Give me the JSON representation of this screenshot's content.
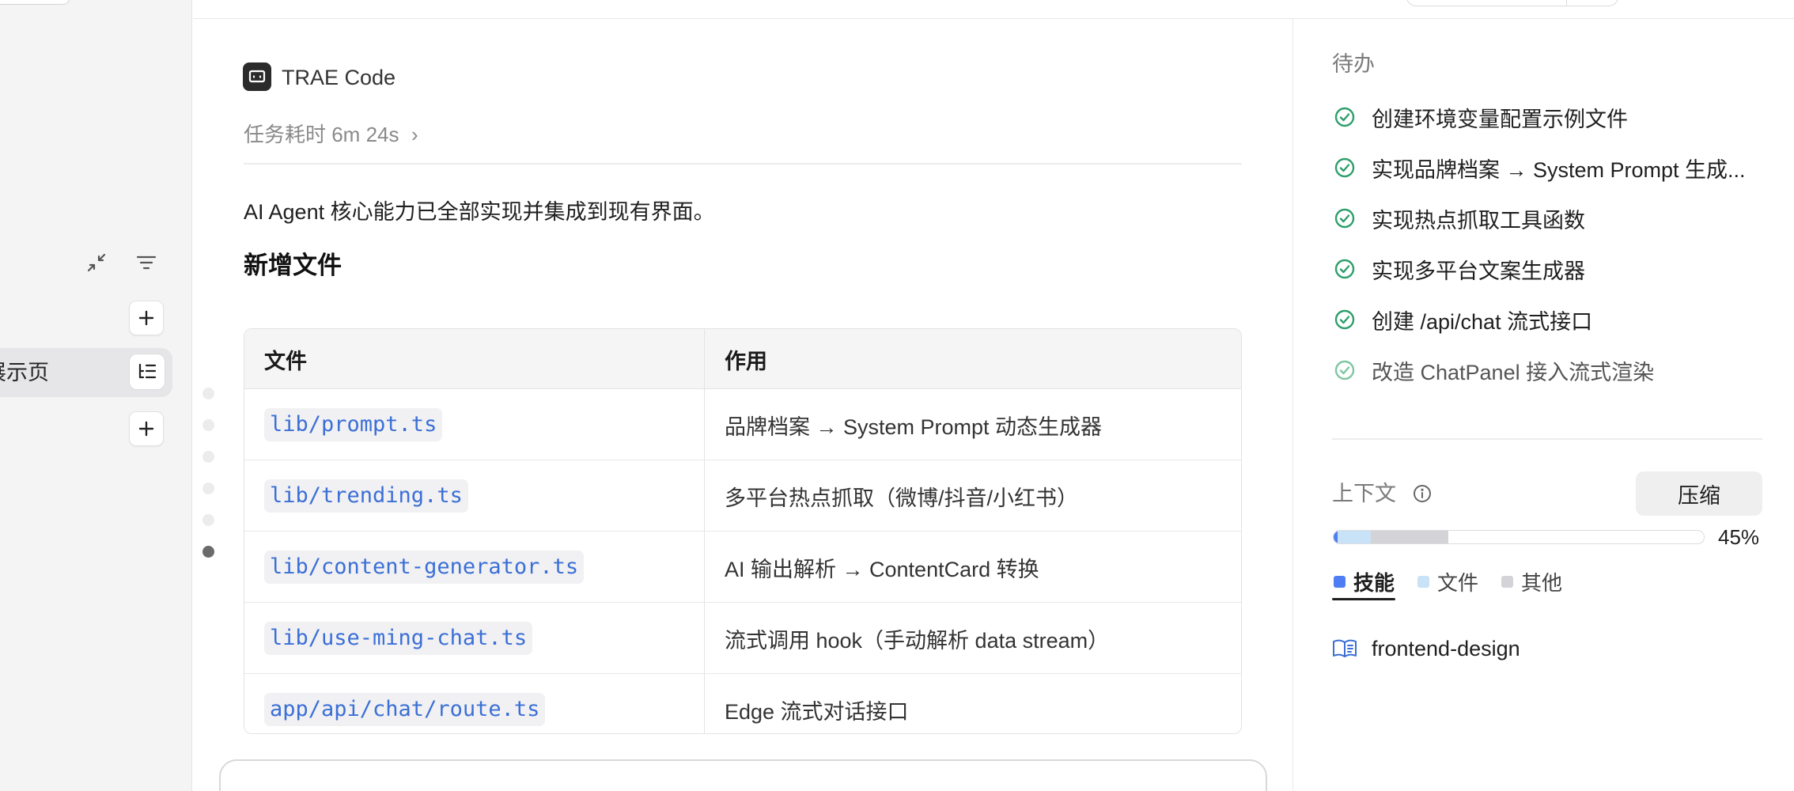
{
  "sidebar": {
    "item_label": "展示页"
  },
  "main": {
    "agent_name": "TRAE Code",
    "task_time": "任务耗时 6m 24s",
    "summary": "AI Agent 核心能力已全部实现并集成到现有界面。",
    "section_title": "新增文件",
    "table": {
      "headers": [
        "文件",
        "作用"
      ],
      "rows": [
        {
          "file": "lib/prompt.ts",
          "desc": "品牌档案 → System Prompt 动态生成器"
        },
        {
          "file": "lib/trending.ts",
          "desc": "多平台热点抓取（微博/抖音/小红书）"
        },
        {
          "file": "lib/content-generator.ts",
          "desc": "AI 输出解析 → ContentCard 转换"
        },
        {
          "file": "lib/use-ming-chat.ts",
          "desc": "流式调用 hook（手动解析 data stream）"
        },
        {
          "file": "app/api/chat/route.ts",
          "desc": "Edge 流式对话接口"
        }
      ]
    }
  },
  "right_panel": {
    "todo_title": "待办",
    "todos": [
      {
        "text": "创建环境变量配置示例文件",
        "status": "done"
      },
      {
        "text": "实现品牌档案 → System Prompt 生成...",
        "status": "done"
      },
      {
        "text": "实现热点抓取工具函数",
        "status": "done"
      },
      {
        "text": "实现多平台文案生成器",
        "status": "done"
      },
      {
        "text": "创建 /api/chat 流式接口",
        "status": "done"
      },
      {
        "text": "改造 ChatPanel 接入流式渲染",
        "status": "pending"
      }
    ],
    "context": {
      "title": "上下文",
      "compress_label": "压缩",
      "percent_label": "45%",
      "usage_fractions": {
        "skills": 0.01,
        "files": 0.09,
        "other": 0.21
      },
      "legend": [
        {
          "label": "技能",
          "color": "#4f7df3"
        },
        {
          "label": "文件",
          "color": "#c8e2f8"
        },
        {
          "label": "其他",
          "color": "#d4d4d8"
        }
      ],
      "skill_name": "frontend-design"
    }
  },
  "colors": {
    "check_done": "#2e9e6b",
    "check_pending": "#7fc6a3",
    "code_text": "#3b6fd6"
  },
  "icons": {
    "agent_logo": "terminal-chat-icon",
    "collapse": "collapse-arrows-icon",
    "filter": "filter-lines-icon",
    "add": "plus-icon",
    "outline": "list-tree-icon",
    "info": "info-circle-icon",
    "skill": "book-icon",
    "check": "check-circle-icon"
  }
}
